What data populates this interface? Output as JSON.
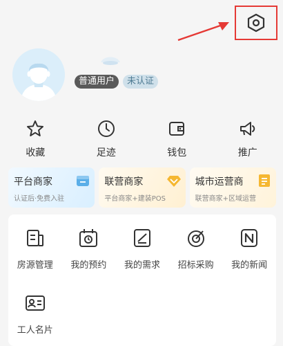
{
  "header": {
    "settings_icon": "hexagon-settings-icon",
    "arrow_color": "#e53935"
  },
  "profile": {
    "avatar_icon": "default-avatar-icon",
    "badge_user": "普通用户",
    "badge_cert": "未认证"
  },
  "quick_actions": [
    {
      "label": "收藏",
      "icon": "star-icon"
    },
    {
      "label": "足迹",
      "icon": "clock-icon"
    },
    {
      "label": "钱包",
      "icon": "wallet-icon"
    },
    {
      "label": "推广",
      "icon": "megaphone-icon"
    }
  ],
  "merchant_cards": [
    {
      "title": "平台商家",
      "subtitle": "认证后·免费入驻",
      "icon": "store-icon",
      "icon_color": "#5aaee8"
    },
    {
      "title": "联营商家",
      "subtitle": "平台商家+建装POS",
      "icon": "diamond-icon",
      "icon_color": "#f5b731"
    },
    {
      "title": "城市运营商",
      "subtitle": "联营商家+区域运营",
      "icon": "document-icon",
      "icon_color": "#f5b731"
    }
  ],
  "services": [
    {
      "label": "房源管理",
      "icon": "listing-icon"
    },
    {
      "label": "我的预约",
      "icon": "calendar-icon"
    },
    {
      "label": "我的需求",
      "icon": "edit-list-icon"
    },
    {
      "label": "招标采购",
      "icon": "target-icon"
    },
    {
      "label": "我的新闻",
      "icon": "news-icon"
    },
    {
      "label": "工人名片",
      "icon": "id-card-icon"
    }
  ]
}
